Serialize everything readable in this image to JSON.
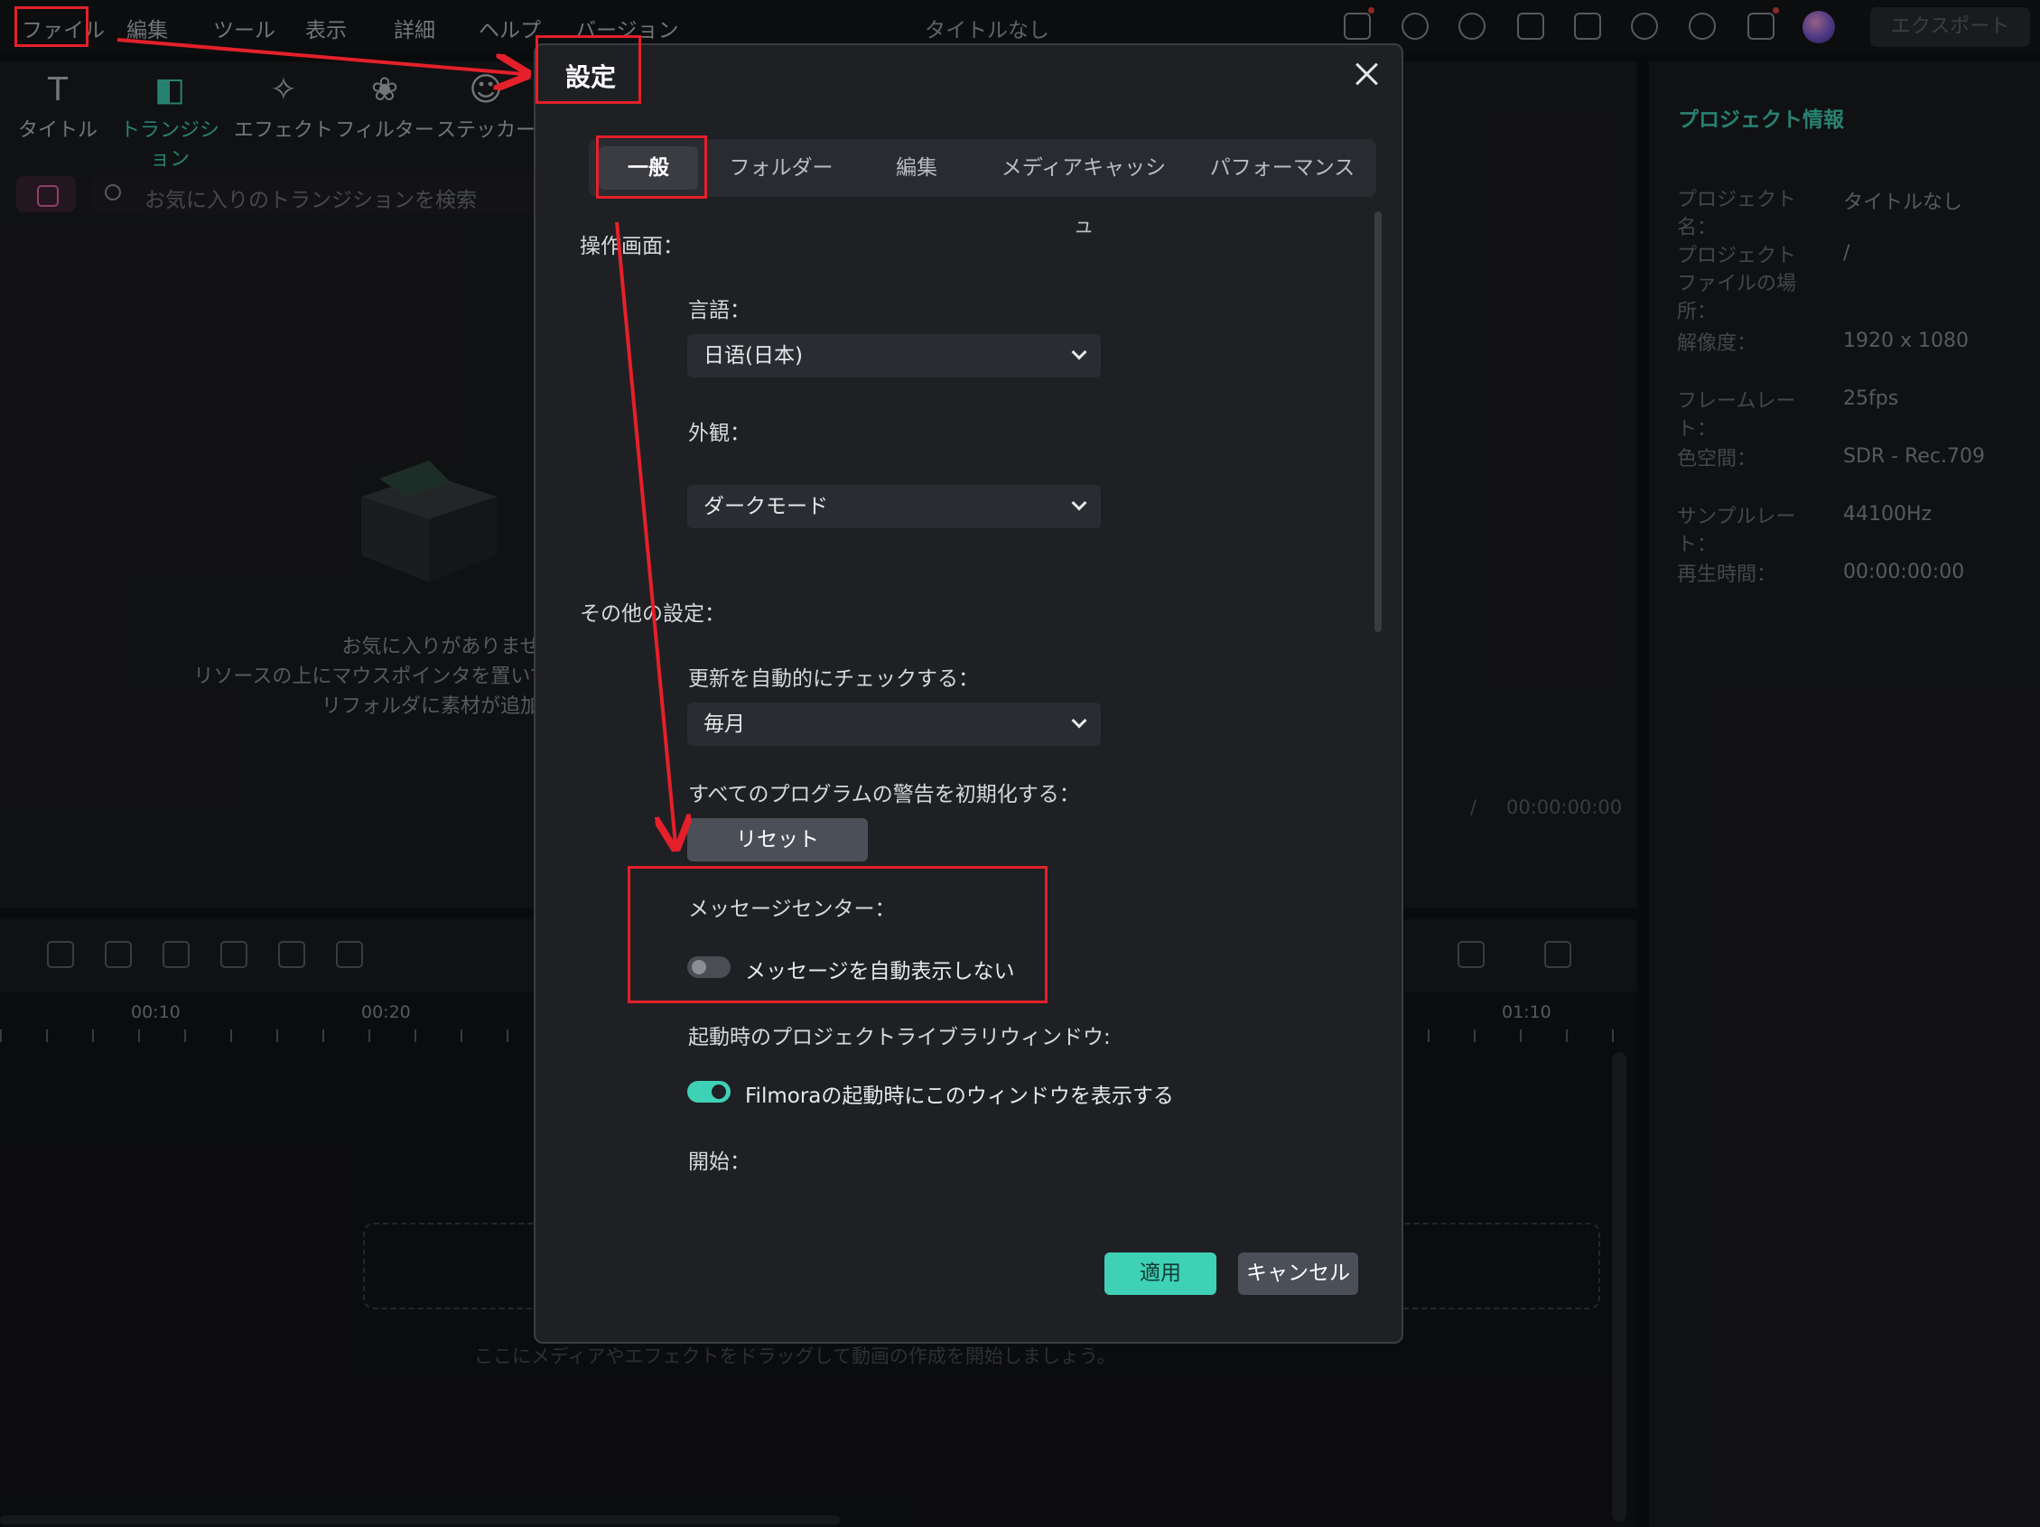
{
  "menubar": {
    "items": [
      "ファイル",
      "編集",
      "ツール",
      "表示",
      "詳細",
      "ヘルプ",
      "バージョン"
    ],
    "window_title": "タイトルなし",
    "export_label": "エクスポート",
    "icons": [
      "gift-icon",
      "send-icon",
      "brush-icon",
      "layout-icon",
      "save-icon",
      "cloud-icon",
      "headset-icon",
      "apps-icon"
    ]
  },
  "toolbar": {
    "items": [
      {
        "label": "タイトル",
        "icon": "title-icon"
      },
      {
        "label": "トランジション",
        "icon": "transition-icon"
      },
      {
        "label": "エフェクト",
        "icon": "effect-icon"
      },
      {
        "label": "フィルター",
        "icon": "filter-icon"
      },
      {
        "label": "ステッカー",
        "icon": "sticker-icon"
      }
    ],
    "active_color": "#3fd1b6"
  },
  "search": {
    "placeholder": "お気に入りのトランジションを検索"
  },
  "empty_state": {
    "line1": "お気に入りがありません。",
    "line2": "リソースの上にマウスポインタを置いて「お気に入り」アイ",
    "line3": "リフォルダに素材が追加されま"
  },
  "project_info": {
    "title": "プロジェクト情報",
    "rows": [
      {
        "label": "プロジェクト名：",
        "value": "タイトルなし"
      },
      {
        "label": "プロジェクトファイルの場所：",
        "value": "/"
      },
      {
        "label": "解像度：",
        "value": "1920 x 1080"
      },
      {
        "label": "フレームレート：",
        "value": "25fps"
      },
      {
        "label": "色空間：",
        "value": "SDR - Rec.709"
      },
      {
        "label": "サンプルレート：",
        "value": "44100Hz"
      },
      {
        "label": "再生時間：",
        "value": "00:00:00:00"
      }
    ]
  },
  "preview": {
    "slash": "/",
    "time": "00:00:00:00"
  },
  "timeline": {
    "ticks": [
      "00:10",
      "00:20",
      "01:10"
    ],
    "drop_hint": "ここにメディアやエフェクトをドラッグして動画の作成を開始しましょう。"
  },
  "dialog": {
    "title": "設定",
    "tabs": [
      "一般",
      "フォルダー",
      "編集",
      "メディアキャッシュ",
      "パフォーマンス"
    ],
    "active_tab": "一般",
    "ui_section": "操作画面：",
    "language_label": "言語：",
    "language_value": "日语(日本)",
    "appearance_label": "外観：",
    "appearance_value": "ダークモード",
    "other_section": "その他の設定：",
    "update_label": "更新を自動的にチェックする：",
    "update_value": "毎月",
    "reset_warnings_label": "すべてのプログラムの警告を初期化する：",
    "reset_button": "リセット",
    "message_center_label": "メッセージセンター：",
    "message_toggle_label": "メッセージを自動表示しない",
    "message_toggle_on": false,
    "startup_label": "起動時のプロジェクトライブラリウィンドウ:",
    "startup_toggle_label": "Filmoraの起動時にこのウィンドウを表示する",
    "startup_toggle_on": true,
    "start_label": "開始：",
    "apply_button": "適用",
    "cancel_button": "キャンセル"
  },
  "annotation_color": "#e5202a"
}
